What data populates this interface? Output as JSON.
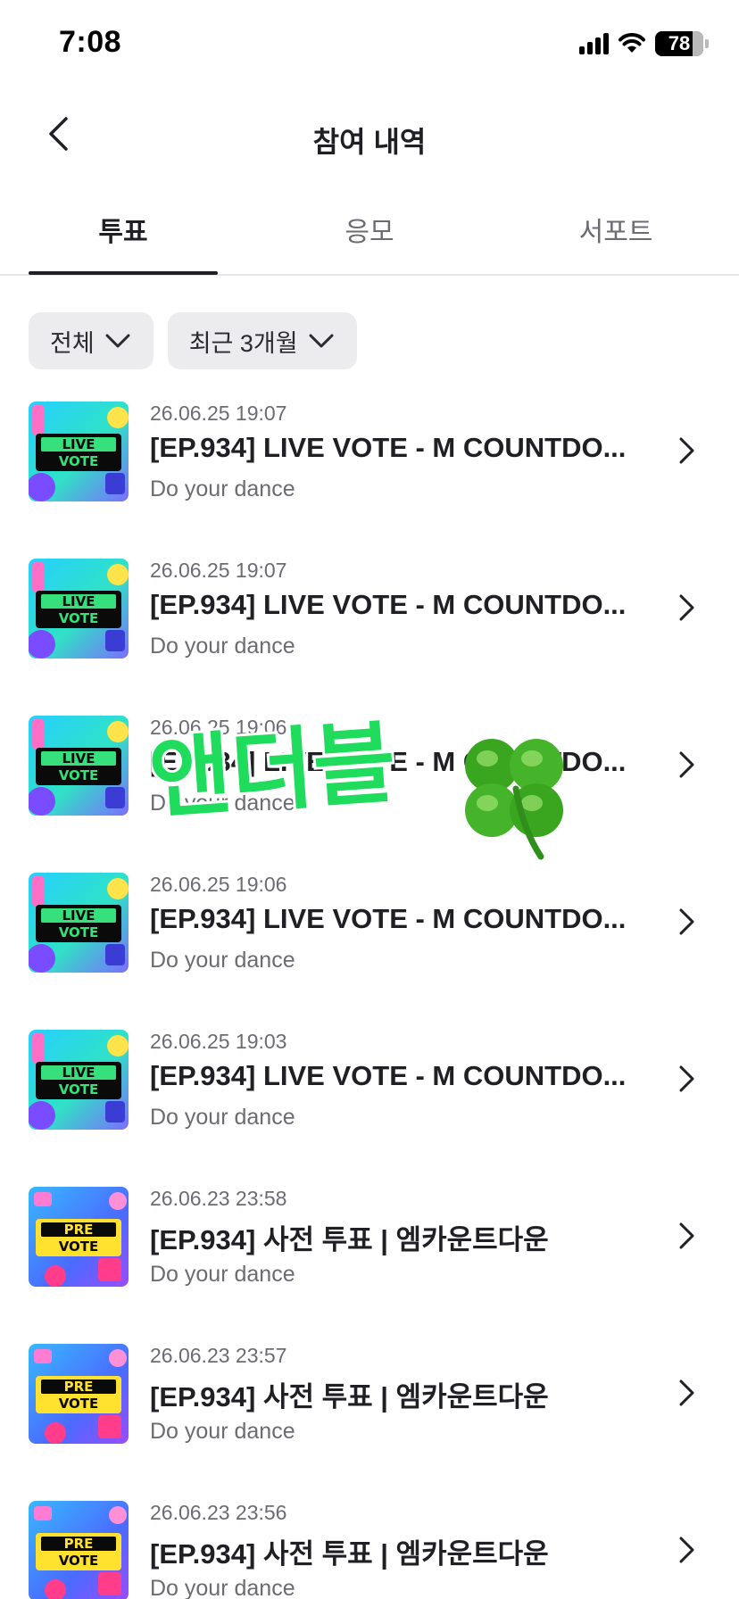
{
  "status_bar": {
    "time": "7:08",
    "battery": "78"
  },
  "header": {
    "title": "참여 내역"
  },
  "tabs": [
    {
      "label": "투표",
      "active": true
    },
    {
      "label": "응모",
      "active": false
    },
    {
      "label": "서포트",
      "active": false
    }
  ],
  "filters": [
    {
      "label": "전체"
    },
    {
      "label": "최근 3개월"
    }
  ],
  "items": [
    {
      "date": "26.06.25 19:07",
      "title": "[EP.934] LIVE VOTE - M COUNTDO...",
      "subtitle": "Do your dance",
      "badge_top": "LIVE",
      "badge_bottom": "VOTE",
      "thumb_icon": "live-vote-icon"
    },
    {
      "date": "26.06.25 19:07",
      "title": "[EP.934] LIVE VOTE - M COUNTDO...",
      "subtitle": "Do your dance",
      "badge_top": "LIVE",
      "badge_bottom": "VOTE",
      "thumb_icon": "live-vote-icon"
    },
    {
      "date": "26.06.25 19:06",
      "title": "[EP.934] LIVE VOTE - M COUNTDO...",
      "subtitle": "Do your dance",
      "badge_top": "LIVE",
      "badge_bottom": "VOTE",
      "thumb_icon": "live-vote-icon"
    },
    {
      "date": "26.06.25 19:06",
      "title": "[EP.934] LIVE VOTE - M COUNTDO...",
      "subtitle": "Do your dance",
      "badge_top": "LIVE",
      "badge_bottom": "VOTE",
      "thumb_icon": "live-vote-icon"
    },
    {
      "date": "26.06.25 19:03",
      "title": "[EP.934] LIVE VOTE - M COUNTDO...",
      "subtitle": "Do your dance",
      "badge_top": "LIVE",
      "badge_bottom": "VOTE",
      "thumb_icon": "live-vote-icon"
    },
    {
      "date": "26.06.23 23:58",
      "title": "[EP.934] 사전 투표 | 엠카운트다운",
      "subtitle": "Do your dance",
      "badge_top": "PRE",
      "badge_bottom": "VOTE",
      "thumb_icon": "pre-vote-icon"
    },
    {
      "date": "26.06.23 23:57",
      "title": "[EP.934] 사전 투표 | 엠카운트다운",
      "subtitle": "Do your dance",
      "badge_top": "PRE",
      "badge_bottom": "VOTE",
      "thumb_icon": "pre-vote-icon"
    },
    {
      "date": "26.06.23 23:56",
      "title": "[EP.934] 사전 투표 | 엠카운트다운",
      "subtitle": "Do your dance",
      "badge_top": "PRE",
      "badge_bottom": "VOTE",
      "thumb_icon": "pre-vote-icon"
    }
  ],
  "watermark": {
    "text": "앤더블",
    "icon": "four-leaf-clover-icon"
  },
  "colors": {
    "text_primary": "#1f1f24",
    "text_secondary": "#6b6b73",
    "chip_bg": "#ececef",
    "watermark_green": "#1fdc5c"
  }
}
